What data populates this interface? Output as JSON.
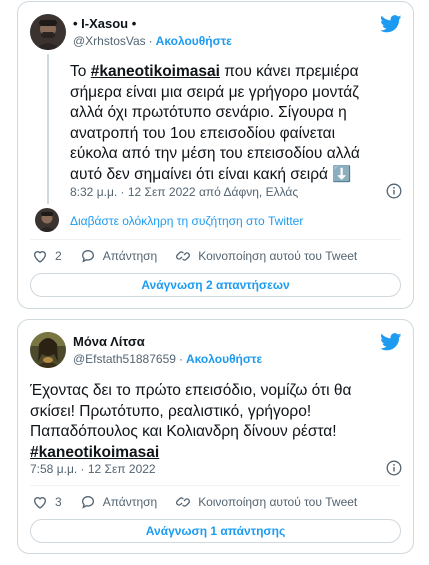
{
  "tweets": [
    {
      "display_name": "• I-Xasou •",
      "handle": "@XrhstosVas",
      "follow_label": "Ακολουθήστε",
      "text_before": "Το ",
      "hashtag": "#kaneotikoimasai",
      "text_after": " που κάνει πρεμιέρα\nσήμερα είναι μια σειρά με γρήγορο μοντάζ\nαλλά όχι πρωτότυπο σενάριο. Σίγουρα η\nανατροπή του 1ου επεισοδίου φαίνεται\nεύκολα από την μέση του επεισοδίου αλλά\nαυτό δεν σημαίνει ότι είναι κακή σειρά ",
      "emoji": "⬇️",
      "timestamp": "8:32 μ.μ. · 12 Σεπ 2022 από Δάφνη, Ελλάς",
      "read_thread": "Διαβάστε ολόκληρη τη συζήτηση στο Twitter",
      "like_count": "2",
      "reply_label": "Απάντηση",
      "share_label": "Κοινοποίηση αυτού του Tweet",
      "replies_button": "Ανάγνωση 2 απαντήσεων"
    },
    {
      "display_name": "Μόνα Λίτσα",
      "handle": "@Efstath51887659",
      "follow_label": "Ακολουθήστε",
      "text_before": "Έχοντας δει το πρώτο επεισόδιο, νομίζω ότι θα\nσκίσει! Πρωτότυπο, ρεαλιστικό, γρήγορο!\nΠαπαδόπουλος και Κολιανδρη δίνουν ρέστα!\n",
      "hashtag": "#kaneotikoimasai",
      "timestamp": "7:58 μ.μ. · 12 Σεπ 2022",
      "like_count": "3",
      "reply_label": "Απάντηση",
      "share_label": "Κοινοποίηση αυτού του Tweet",
      "replies_button": "Ανάγνωση 1 απάντησης"
    }
  ],
  "colors": {
    "accent": "#1d9bf0",
    "text": "#0f1419",
    "muted": "#536471",
    "border": "#cfd9de"
  }
}
